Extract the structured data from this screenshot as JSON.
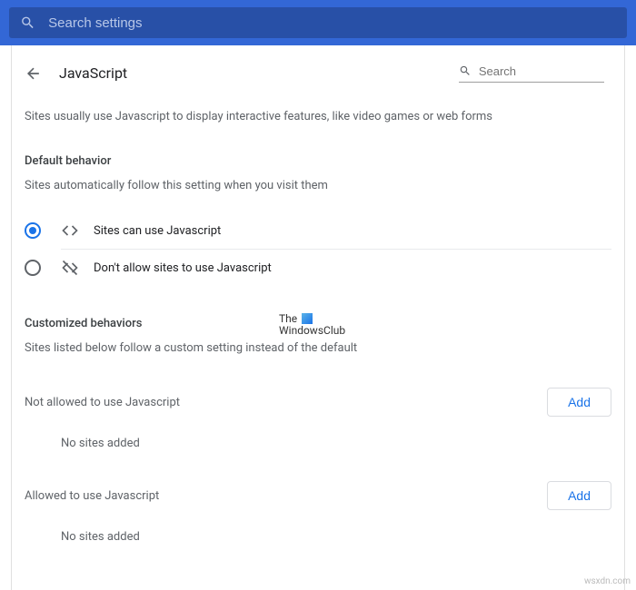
{
  "topSearch": {
    "placeholder": "Search settings"
  },
  "header": {
    "title": "JavaScript",
    "searchPlaceholder": "Search"
  },
  "intro": "Sites usually use Javascript to display interactive features, like video games or web forms",
  "defaultBehavior": {
    "heading": "Default behavior",
    "sub": "Sites automatically follow this setting when you visit them",
    "options": [
      {
        "label": "Sites can use Javascript",
        "checked": true
      },
      {
        "label": "Don't allow sites to use Javascript",
        "checked": false
      }
    ]
  },
  "customized": {
    "heading": "Customized behaviors",
    "sub": "Sites listed below follow a custom setting instead of the default",
    "lists": [
      {
        "label": "Not allowed to use Javascript",
        "button": "Add",
        "empty": "No sites added"
      },
      {
        "label": "Allowed to use Javascript",
        "button": "Add",
        "empty": "No sites added"
      }
    ]
  },
  "watermark": {
    "line1": "The",
    "line2": "WindowsClub"
  },
  "footer": "wsxdn.com"
}
